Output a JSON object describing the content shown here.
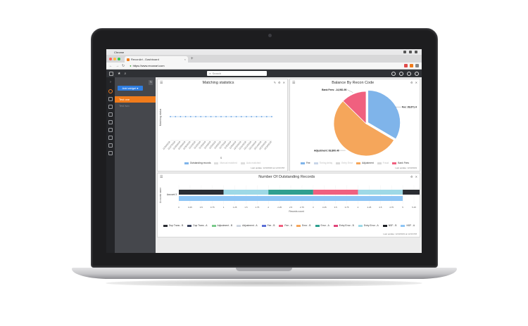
{
  "mac": {
    "app_name": "Chrome"
  },
  "browser": {
    "tab_title": "ReconArt - Dashboard",
    "new_tab": "+",
    "close": "×",
    "url": "https://www.reconart.com"
  },
  "app": {
    "search_placeholder": "Search",
    "add_button": "Add widget ▾",
    "refresh": "↻",
    "sidebar_active": "Test one",
    "sidebar_inactive": "Test two"
  },
  "colors": {
    "accent_orange": "#f07b1b",
    "accent_blue": "#2e7de0",
    "fee": "#7fb4ea",
    "adjustment": "#f5a65b",
    "bank_fees": "#f0607f"
  },
  "matching": {
    "title": "Matching statistics",
    "ylabel": "Matching status",
    "xaxis_name": "S",
    "legend": [
      "Outstanding records",
      "Manual matched",
      "Auto matched"
    ],
    "updated": "Last update: 12/3/2019 at 12:03 PM",
    "dates": [
      "11/26/2019",
      "11/27/2019",
      "11/28/2019",
      "11/29/2019",
      "11/30/2019",
      "12/1/2019",
      "12/2/2019",
      "12/3/2019",
      "12/4/2019",
      "12/5/2019",
      "12/6/2019",
      "12/7/2019",
      "12/8/2019",
      "12/9/2019",
      "12/10/2019",
      "12/11/2019",
      "12/12/2019",
      "12/13/2019",
      "12/14/2019",
      "12/15/2019",
      "12/16/2019"
    ]
  },
  "balance": {
    "title": "Balance By Recon Code",
    "legend": [
      "Fee",
      "Timing delay",
      "Entry Error",
      "Adjustment",
      "Fraud",
      "Bank Fees"
    ],
    "legend_off": [
      false,
      true,
      true,
      false,
      true,
      false
    ],
    "legend_colors": [
      "#7fb4ea",
      "#c9d6e8",
      "#d8d8d8",
      "#f5a65b",
      "#d8d8d8",
      "#f0607f"
    ],
    "updated": "Last update: 12/3/2019",
    "labels": {
      "fee": "Fee: 39,671.48",
      "adjustment": "Adjustment: 63,800.40",
      "bank_fees": "Bank Fees: -14,981.90"
    }
  },
  "outstanding": {
    "title": "Number Of Outstanding Records",
    "ylabel": "Accounts name",
    "xlabel": "Records count",
    "category": "Account 3",
    "ticks": [
      "0",
      "0.25",
      "0.5",
      "0.75",
      "1",
      "1.25",
      "1.5",
      "1.75",
      "2",
      "2.25",
      "2.5",
      "2.75",
      "3",
      "3.25",
      "3.5",
      "3.75",
      "4",
      "4.25",
      "4.5",
      "4.75",
      "5",
      "5.25"
    ],
    "updated": "Last update: 12/3/2019 at 12:03 PM",
    "legend": [
      "Dup Trans - B",
      "Dup Trans - A",
      "Adjustment - B",
      "Adjustment - A",
      "Fee - B",
      "Fee - A",
      "Error - B",
      "Error - A",
      "Entry Error - B",
      "Entry Error - A",
      "NSF - B",
      "NSF - A"
    ],
    "legend_colors": [
      "#2b2d33",
      "#39425c",
      "#79c98a",
      "#cfd6e0",
      "#5b6fd6",
      "#f0607f",
      "#f5a65b",
      "#2e9f8f",
      "#e0457a",
      "#9ed9e6",
      "#1d1f24",
      "#8ec5f5"
    ]
  },
  "chart_data": [
    {
      "type": "line",
      "title": "Matching statistics",
      "ylabel": "Matching status",
      "xlabel": "S",
      "x": [
        "11/26/2019",
        "11/27/2019",
        "11/28/2019",
        "11/29/2019",
        "11/30/2019",
        "12/1/2019",
        "12/2/2019",
        "12/3/2019",
        "12/4/2019",
        "12/5/2019",
        "12/6/2019",
        "12/7/2019",
        "12/8/2019",
        "12/9/2019",
        "12/10/2019",
        "12/11/2019",
        "12/12/2019",
        "12/13/2019",
        "12/14/2019",
        "12/15/2019",
        "12/16/2019"
      ],
      "series": [
        {
          "name": "Outstanding records",
          "values": [
            0,
            0,
            0,
            0,
            0,
            0,
            0,
            0,
            0,
            0,
            0,
            0,
            0,
            0,
            0,
            0,
            0,
            0,
            0,
            0,
            0
          ]
        }
      ],
      "legend": "bottom"
    },
    {
      "type": "pie",
      "title": "Balance By Recon Code",
      "slices": [
        {
          "name": "Fee",
          "value": 39671.48,
          "color": "#7fb4ea"
        },
        {
          "name": "Adjustment",
          "value": 63800.4,
          "color": "#f5a65b"
        },
        {
          "name": "Bank Fees",
          "value": 14981.9,
          "color": "#f0607f"
        }
      ],
      "legend": "bottom"
    },
    {
      "type": "bar",
      "orientation": "horizontal",
      "stacked": true,
      "title": "Number Of Outstanding Records",
      "categories": [
        "Account 3"
      ],
      "xlabel": "Records count",
      "ylabel": "Accounts name",
      "xlim": [
        0,
        5.25
      ],
      "series": [
        {
          "name": "Dup Trans - B",
          "values": [
            1
          ],
          "color": "#2b2d33"
        },
        {
          "name": "Adjustment - A",
          "values": [
            1
          ],
          "color": "#9ed9e6"
        },
        {
          "name": "Error - A",
          "values": [
            1
          ],
          "color": "#2e9f8f"
        },
        {
          "name": "Fee - A",
          "values": [
            1
          ],
          "color": "#f0607f"
        },
        {
          "name": "Entry Error - A",
          "values": [
            1
          ],
          "color": "#9ed9e6"
        },
        {
          "name": "NSF - B",
          "values": [
            1
          ],
          "color": "#2b2d33"
        },
        {
          "name": "NSF - A",
          "values": [
            5
          ],
          "color": "#8ec5f5"
        }
      ],
      "legend": "bottom"
    }
  ]
}
